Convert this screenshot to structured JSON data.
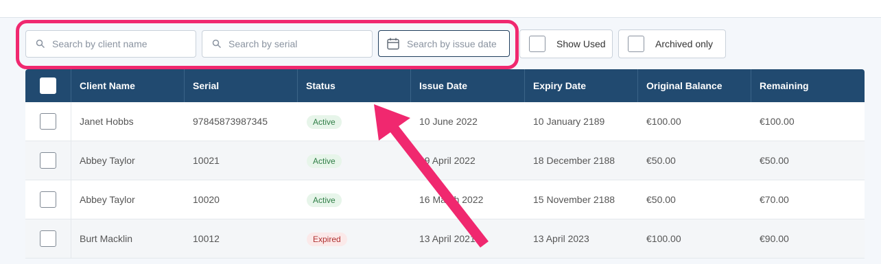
{
  "filters": {
    "client_placeholder": "Search by client name",
    "serial_placeholder": "Search by serial",
    "date_placeholder": "Search by issue date",
    "show_used_label": "Show Used",
    "archived_only_label": "Archived only"
  },
  "table": {
    "columns": [
      "Client Name",
      "Serial",
      "Status",
      "Issue Date",
      "Expiry Date",
      "Original Balance",
      "Remaining"
    ],
    "rows": [
      {
        "client": "Janet Hobbs",
        "serial": "97845873987345",
        "status": "Active",
        "issue": "10 June 2022",
        "expiry": "10 January 2189",
        "original": "€100.00",
        "remaining": "€100.00"
      },
      {
        "client": "Abbey Taylor",
        "serial": "10021",
        "status": "Active",
        "issue": "19 April 2022",
        "expiry": "18 December 2188",
        "original": "€50.00",
        "remaining": "€50.00"
      },
      {
        "client": "Abbey Taylor",
        "serial": "10020",
        "status": "Active",
        "issue": "16 March 2022",
        "expiry": "15 November 2188",
        "original": "€50.00",
        "remaining": "€70.00"
      },
      {
        "client": "Burt Macklin",
        "serial": "10012",
        "status": "Expired",
        "issue": "13 April 2021",
        "expiry": "13 April 2023",
        "original": "€100.00",
        "remaining": "€90.00"
      }
    ]
  },
  "colors": {
    "header_bg": "#214a70",
    "highlight": "#f0286f",
    "active_text": "#2e7d45",
    "expired_text": "#b03030"
  },
  "icons": {
    "client_search": "search-icon",
    "serial_search": "search-icon",
    "date_search": "calendar-icon",
    "annotation": "arrow-icon"
  }
}
